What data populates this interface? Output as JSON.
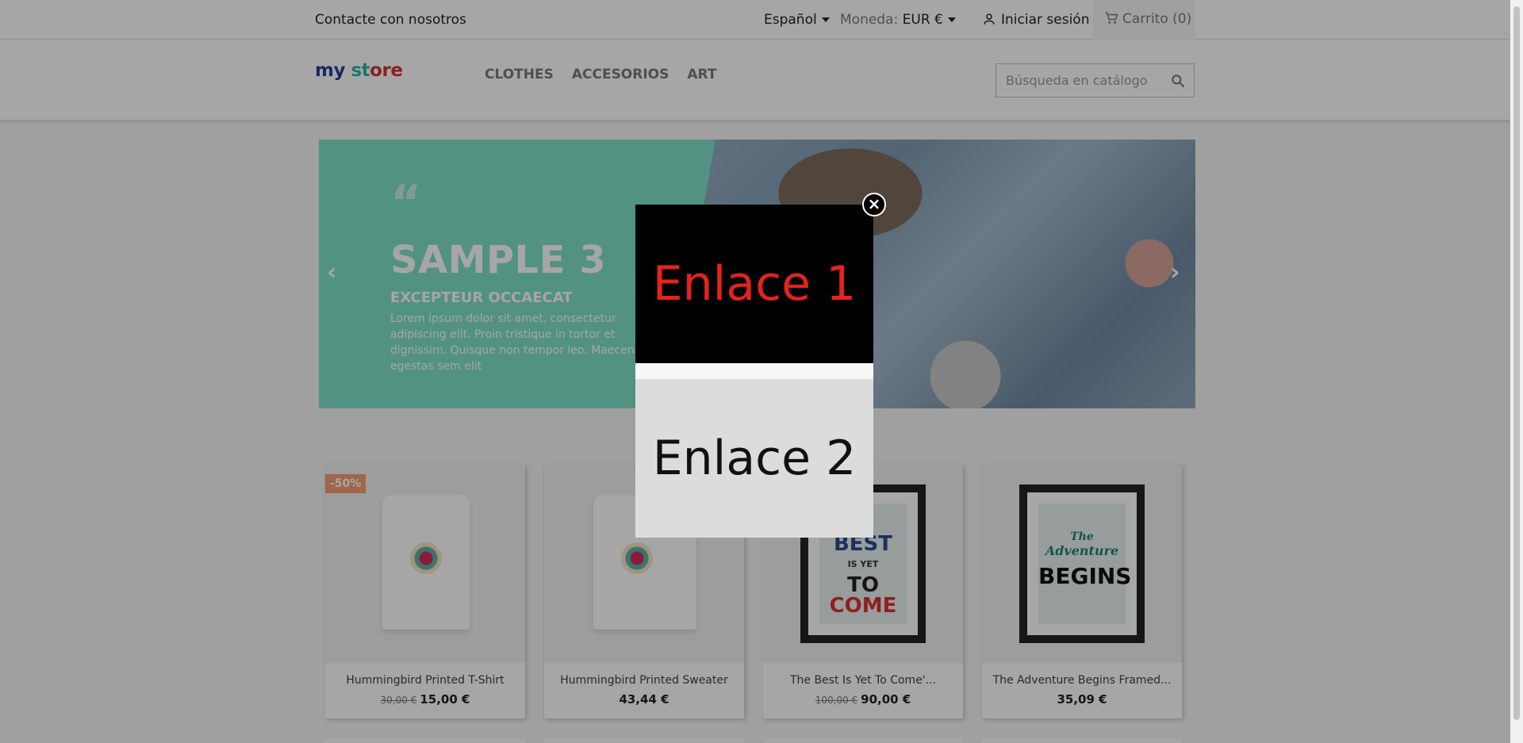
{
  "topbar": {
    "contact": "Contacte con nosotros",
    "language": "Español",
    "currency_label": "Moneda:",
    "currency_value": "EUR €",
    "signin": "Iniciar sesión",
    "cart": "Carrito (0)"
  },
  "header": {
    "logo_parts": [
      "my",
      " ",
      "st",
      "ore"
    ],
    "nav": [
      "CLOTHES",
      "ACCESORIOS",
      "ART"
    ],
    "search_placeholder": "Búsqueda en catálogo"
  },
  "carousel": {
    "quote": "“",
    "title": "SAMPLE 3",
    "subtitle": "EXCEPTEUR OCCAECAT",
    "body": "Lorem ipsum dolor sit amet, consectetur adipiscing elit. Proin tristique in tortor et dignissim. Quisque non tempor leo. Maecenas egestas sem elit"
  },
  "products": [
    {
      "name": "Hummingbird Printed T-Shirt",
      "regular_price": "30,00 €",
      "price": "15,00 €",
      "badge": "-50%"
    },
    {
      "name": "Hummingbird Printed Sweater",
      "regular_price": "",
      "price": "43,44 €",
      "badge": ""
    },
    {
      "name": "The Best Is Yet To Come'...",
      "regular_price": "100,00 €",
      "price": "90,00 €",
      "badge": ""
    },
    {
      "name": "The Adventure Begins Framed...",
      "regular_price": "",
      "price": "35,09 €",
      "badge": ""
    }
  ],
  "posters": {
    "best": [
      "BEST",
      "IS YET",
      "TO",
      "COME"
    ],
    "adventure": [
      "The",
      "Adventure",
      "BEGINS"
    ]
  },
  "modal": {
    "link1": "Enlace 1",
    "link2": "Enlace 2",
    "close": "×"
  },
  "colors": {
    "link1_text": "#e4231c",
    "link1_bg": "#000000",
    "link2_bg": "#dcdcdc",
    "badge": "#f39d72"
  }
}
